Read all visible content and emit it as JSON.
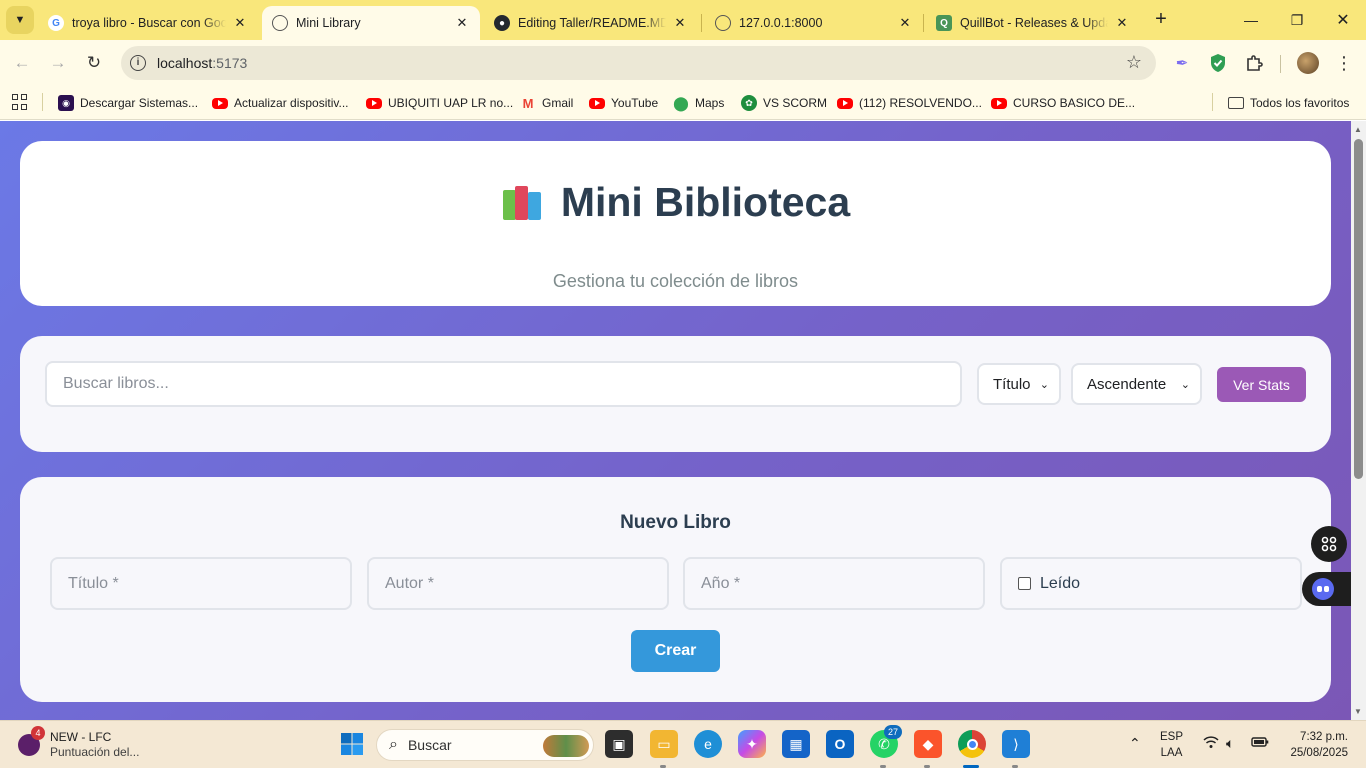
{
  "browser": {
    "tabs": [
      {
        "title": "troya libro - Buscar con Google",
        "icon": "google-icon",
        "active": false
      },
      {
        "title": "Mini Library",
        "icon": "globe-icon",
        "active": true
      },
      {
        "title": "Editing Taller/README.MD at main",
        "icon": "github-icon",
        "active": false
      },
      {
        "title": "127.0.0.1:8000",
        "icon": "globe-icon",
        "active": false
      },
      {
        "title": "QuillBot - Releases & Updates",
        "icon": "quillbot-icon",
        "active": false
      }
    ],
    "address": {
      "host": "localhost",
      "port": ":5173"
    },
    "bookmarks": [
      {
        "label": "Descargar Sistemas...",
        "icon": "purple-logo-icon"
      },
      {
        "label": "Actualizar dispositiv...",
        "icon": "youtube-icon"
      },
      {
        "label": "UBIQUITI UAP LR no...",
        "icon": "youtube-icon"
      },
      {
        "label": "Gmail",
        "icon": "gmail-icon"
      },
      {
        "label": "YouTube",
        "icon": "youtube-icon"
      },
      {
        "label": "Maps",
        "icon": "maps-icon"
      },
      {
        "label": "VS SCORM",
        "icon": "green-circle-icon"
      },
      {
        "label": "(112) RESOLVENDO...",
        "icon": "youtube-icon"
      },
      {
        "label": "CURSO BASICO DE...",
        "icon": "youtube-icon"
      }
    ],
    "all_bookmarks_label": "Todos los favoritos"
  },
  "page": {
    "title": "Mini Biblioteca",
    "subtitle": "Gestiona tu colección de libros",
    "search": {
      "placeholder": "Buscar libros...",
      "sort_field": "Título",
      "sort_order": "Ascendente",
      "stats_button": "Ver Stats"
    },
    "form": {
      "title": "Nuevo Libro",
      "title_placeholder": "Título *",
      "author_placeholder": "Autor *",
      "year_placeholder": "Año *",
      "read_label": "Leído",
      "create_button": "Crear"
    }
  },
  "taskbar": {
    "news_title": "NEW - LFC",
    "news_sub": "Puntuación del...",
    "news_badge": "4",
    "search_placeholder": "Buscar",
    "whatsapp_badge": "27",
    "lang_top": "ESP",
    "lang_bottom": "LAA",
    "time": "7:32 p.m.",
    "date": "25/08/2025"
  },
  "colors": {
    "tabstrip": "#f9e77b",
    "page_gradient_start": "#6b79e6",
    "page_gradient_end": "#7b57b6",
    "stats_button": "#9b59b6",
    "create_button": "#3498db",
    "heading": "#2c3e50"
  }
}
